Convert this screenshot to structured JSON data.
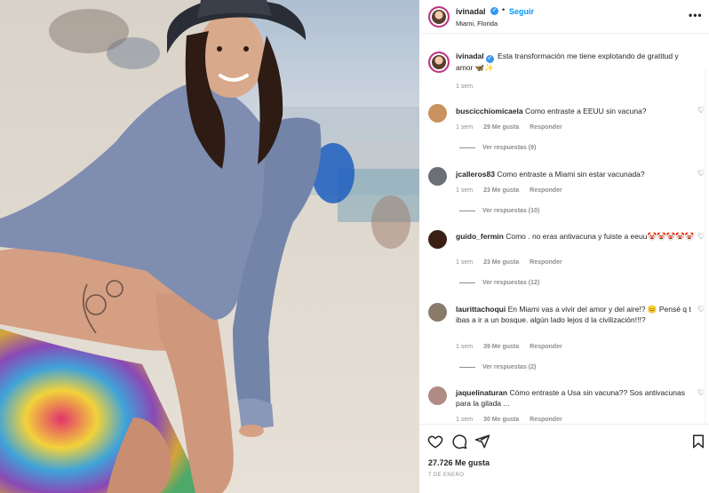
{
  "post": {
    "username": "ivinadal",
    "verified_mark": "✓",
    "separator": "•",
    "follow_label": "Seguir",
    "location": "Miami, Florida",
    "more_icon": "more-horizontal-icon",
    "more_label": "•••"
  },
  "caption": {
    "username": "ivinadal",
    "text": "Esta transformación me tiene explotando de gratitud y amor 🦋✨",
    "time": "1 sem"
  },
  "comments": [
    {
      "username": "buscicchiomicaela",
      "text": "Como entraste a EEUU sin vacuna?",
      "time": "1 sem",
      "likes": "29 Me gusta",
      "reply": "Responder",
      "replies": "Ver respuestas (9)",
      "avatar_color": "#c9925e"
    },
    {
      "username": "jcalleros83",
      "text": "Como entraste a Miami sin estar vacunada?",
      "time": "1 sem",
      "likes": "23 Me gusta",
      "reply": "Responder",
      "replies": "Ver respuestas (10)",
      "avatar_color": "#6b6f76"
    },
    {
      "username": "guido_fermin",
      "text": "Como . no eras antivacuna y fuiste a eeuu🤡🤡🤡🤡🤡",
      "time": "1 sem",
      "likes": "23 Me gusta",
      "reply": "Responder",
      "replies": "Ver respuestas (12)",
      "avatar_color": "#3a1f14"
    },
    {
      "username": "laurittachoqui",
      "text": "En Miami vas a vivir del amor y del aire!? 😑 Pensé q t ibas a ir a un bosque. algún lado lejos d la civilización!!!?",
      "time": "1 sem",
      "likes": "39 Me gusta",
      "reply": "Responder",
      "replies": "Ver respuestas (2)",
      "avatar_color": "#8a7a6a"
    },
    {
      "username": "jaquelinaturan",
      "text": "Cómo entraste a Usa sin vacuna?? Sos antivacunas para la gilada ...",
      "time": "1 sem",
      "likes": "30 Me gusta",
      "reply": "Responder",
      "replies": "",
      "avatar_color": "#b08b86"
    }
  ],
  "footer": {
    "likes_count": "27.726 Me gusta",
    "date": "7 DE ENERO",
    "icons": [
      "heart-icon",
      "comment-icon",
      "share-icon",
      "bookmark-icon"
    ]
  },
  "colors": {
    "link": "#0095f6",
    "verified": "#3897f0",
    "muted": "#8e8e8e",
    "text": "#262626"
  }
}
